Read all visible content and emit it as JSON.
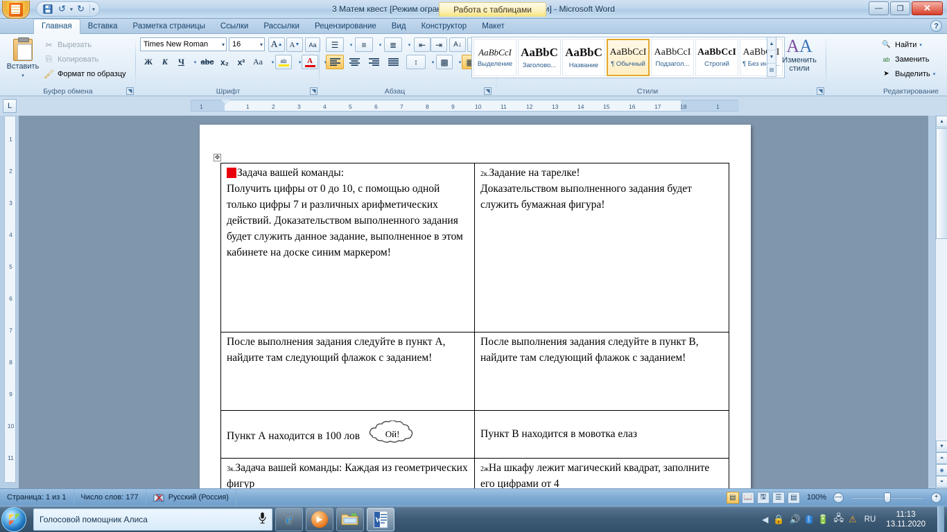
{
  "window": {
    "title": "3 Матем квест [Режим ограниченной функциональности] - Microsoft Word",
    "contextual_tab": "Работа с таблицами",
    "minimize": "—",
    "restore": "❐",
    "close": "✕",
    "help": "?"
  },
  "quick_access": {
    "save": "💾",
    "undo": "↰",
    "redo": "↱",
    "customize": "▾"
  },
  "tabs": [
    {
      "label": "Главная",
      "active": true
    },
    {
      "label": "Вставка",
      "active": false
    },
    {
      "label": "Разметка страницы",
      "active": false
    },
    {
      "label": "Ссылки",
      "active": false
    },
    {
      "label": "Рассылки",
      "active": false
    },
    {
      "label": "Рецензирование",
      "active": false
    },
    {
      "label": "Вид",
      "active": false
    },
    {
      "label": "Конструктор",
      "active": false
    },
    {
      "label": "Макет",
      "active": false
    }
  ],
  "ribbon": {
    "clipboard": {
      "group_label": "Буфер обмена",
      "paste_label": "Вставить",
      "paste_arrow": "▾",
      "cut_label": "Вырезать",
      "cut_icon": "✂",
      "copy_label": "Копировать",
      "copy_icon": "⎘",
      "format_painter_label": "Формат по образцу",
      "format_painter_icon": "🖌"
    },
    "font": {
      "group_label": "Шрифт",
      "font_name": "Times New Roman",
      "font_size": "16",
      "grow_font": "A",
      "shrink_font": "A",
      "clear_format": "Aa",
      "bold": "Ж",
      "italic": "К",
      "underline": "Ч",
      "strikethrough": "abc",
      "subscript": "x₂",
      "superscript": "x²",
      "change_case": "Aa",
      "highlight": "ab",
      "font_color": "A",
      "dropdown": "▾"
    },
    "paragraph": {
      "group_label": "Абзац",
      "bullets": "☰",
      "numbering": "≡",
      "multilevel": "≣",
      "decrease_indent": "⇤",
      "increase_indent": "⇥",
      "sort": "A↓",
      "show_marks": "¶",
      "align_left": "▤",
      "align_center": "▤",
      "align_right": "▤",
      "justify": "▤",
      "line_spacing": "↕",
      "shading": "▩",
      "borders": "▦"
    },
    "styles": {
      "group_label": "Стили",
      "items": [
        {
          "preview": "AaBbCcI",
          "name": "Выделение",
          "selected": false,
          "style": "italic-serif"
        },
        {
          "preview": "AaBbC",
          "name": "Заголово...",
          "selected": false,
          "style": "bold-big"
        },
        {
          "preview": "AaBbC",
          "name": "Название",
          "selected": false,
          "style": "bold-big"
        },
        {
          "preview": "AaBbCcI",
          "name": "¶ Обычный",
          "selected": true,
          "style": "plain"
        },
        {
          "preview": "AaBbCcI",
          "name": "Подзагол...",
          "selected": false,
          "style": "plain"
        },
        {
          "preview": "AaBbCcI",
          "name": "Строгий",
          "selected": false,
          "style": "bold"
        },
        {
          "preview": "AaBbCcI",
          "name": "¶ Без инте...",
          "selected": false,
          "style": "plain"
        }
      ],
      "change_styles_label": "Изменить стили",
      "change_styles_arrow": "▾"
    },
    "editing": {
      "group_label": "Редактирование",
      "find_label": "Найти",
      "find_icon": "🔍",
      "replace_label": "Заменить",
      "replace_icon": "ab",
      "select_label": "Выделить",
      "select_icon": "➤",
      "arrow": "▾"
    }
  },
  "ruler": {
    "tab_selector": "L",
    "h_ticks": [
      "1",
      "1",
      "2",
      "3",
      "4",
      "5",
      "6",
      "7",
      "8",
      "9",
      "10",
      "11",
      "12",
      "13",
      "14",
      "15",
      "16",
      "17",
      "18",
      "1"
    ],
    "v_ticks": [
      "1",
      "2",
      "3",
      "4",
      "5",
      "6",
      "7",
      "8",
      "9",
      "10",
      "11"
    ]
  },
  "document": {
    "table_move_handle": "✥",
    "rows": [
      {
        "left": {
          "marker": "red-square",
          "number": "",
          "paragraphs": [
            "Задача вашей команды:",
            "Получить цифры от 0 до 10, с помощью одной только цифры 7 и различных арифметических действий. Доказательством выполненного задания будет служить данное задание, выполненное в этом кабинете на доске синим маркером!"
          ]
        },
        "right": {
          "number": "2к.",
          "paragraphs": [
            "Задание на тарелке!",
            "Доказательством выполненного задания будет служить бумажная фигура!"
          ]
        }
      },
      {
        "left": {
          "text": "После выполнения задания следуйте в пункт А, найдите там следующий флажок с заданием!"
        },
        "right": {
          "text": "После выполнения задания следуйте в пункт В, найдите там следующий флажок с заданием!"
        }
      },
      {
        "left": {
          "text": "Пункт А находится в 100 лов",
          "callout": "Ой!"
        },
        "right": {
          "text": "Пункт В находится в мовотка елаз"
        }
      },
      {
        "left": {
          "number": "3к.",
          "text": "Задача вашей команды: Каждая из геометрических фигур"
        },
        "right": {
          "number": "2ж",
          "text": "На шкафу лежит магический квадрат, заполните его цифрами от 4"
        }
      }
    ]
  },
  "status_bar": {
    "page": "Страница: 1 из 1",
    "words": "Число слов: 177",
    "proofing_icon": "📖",
    "language": "Русский (Россия)",
    "views": [
      "▤",
      "📖",
      "🖫",
      "☰",
      "▤"
    ],
    "zoom_percent": "100%",
    "zoom_out": "—",
    "zoom_in": "+"
  },
  "taskbar": {
    "start": "start-orb",
    "alice_label": "Голосовой помощник Алиса",
    "mic_icon": "🎤",
    "apps": [
      {
        "name": "internet-explorer",
        "glyph": "e"
      },
      {
        "name": "media-player",
        "glyph": "▶"
      },
      {
        "name": "file-explorer",
        "glyph": "🗂"
      },
      {
        "name": "word",
        "glyph": "W"
      }
    ],
    "tray": [
      "🔒",
      "🔊",
      "ᛒ",
      "🔋",
      "🖧",
      "⚠"
    ],
    "language": "RU",
    "time": "11:13",
    "date": "13.11.2020"
  }
}
